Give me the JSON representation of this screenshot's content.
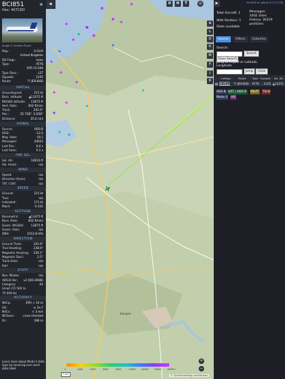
{
  "aircraft": {
    "callsign": "BCI851",
    "hex_label": "Hex:",
    "hex": "407C6D",
    "close": "✕",
    "photo_credit": "Image © Günther Rusch"
  },
  "details": [
    {
      "k": "Reg.:",
      "v": "G-GLO"
    },
    {
      "k": "",
      "v": "United Kingdom"
    },
    {
      "k": "DB Flags:",
      "v": "none"
    },
    {
      "k": "Type:",
      "v": "AT76"
    },
    {
      "k": "",
      "v": "ATR-72-500"
    },
    {
      "k": "Type Desc.:",
      "v": "L2T"
    },
    {
      "k": "Squawk:",
      "v": "2105"
    },
    {
      "k": "Route:",
      "v": "?? JER-BHD"
    }
  ],
  "sections": {
    "spatial": "SPATIAL",
    "signal": "SIGNAL",
    "fms": "FMS SEL",
    "wind": "WIND",
    "speed": "SPEED",
    "altitude": "ALTITUDE",
    "direction": "DIRECTION",
    "stuff": "STUFF",
    "accuracy": "ACCURACY"
  },
  "spatial": [
    {
      "k": "Groundspeed:",
      "v": "215 kt"
    },
    {
      "k": "Baro. altitude:",
      "v": "▲13375 ft"
    },
    {
      "k": "WGS84 altitude:",
      "v": "13675 ft"
    },
    {
      "k": "Vert. Rate:",
      "v": "832 ft/min"
    },
    {
      "k": "Track:",
      "v": "241.6°"
    },
    {
      "k": "Pos.:",
      "v": "52.758°, 5.658°"
    },
    {
      "k": "Distance:",
      "v": "25.6 nmi"
    }
  ],
  "signal": [
    {
      "k": "Source:",
      "v": "ADS-B"
    },
    {
      "k": "RSSI:",
      "v": "-12.5"
    },
    {
      "k": "Msg. Rate:",
      "v": "19.1"
    },
    {
      "k": "Messages:",
      "v": "34622"
    },
    {
      "k": "Last Pos.:",
      "v": "0.4 s"
    },
    {
      "k": "Last Seen:",
      "v": "0.1 s"
    }
  ],
  "fms": [
    {
      "k": "Sel. Alt.:",
      "v": "16016 ft"
    },
    {
      "k": "Sel. Head.:",
      "v": "n/a"
    }
  ],
  "wind": [
    {
      "k": "Speed:",
      "v": "n/a"
    },
    {
      "k": "Direction (from):",
      "v": "n/a"
    },
    {
      "k": "TAT / OAT:",
      "v": "n/a"
    }
  ],
  "speed": [
    {
      "k": "Ground:",
      "v": "215 kt"
    },
    {
      "k": "True:",
      "v": "n/a"
    },
    {
      "k": "Indicated:",
      "v": "171 kt"
    },
    {
      "k": "Mach:",
      "v": "0.332"
    }
  ],
  "altitude": [
    {
      "k": "Barometric:",
      "v": "▲13375 ft"
    },
    {
      "k": "Baro. Rate:",
      "v": "832 ft/min"
    },
    {
      "k": "Geom. WGS84:",
      "v": "13675 ft"
    },
    {
      "k": "Geom. Rate:",
      "v": "n/a"
    },
    {
      "k": "QNH:",
      "v": "1012.8 hPa"
    }
  ],
  "direction": [
    {
      "k": "Ground Track:",
      "v": "241.6°"
    },
    {
      "k": "True Heading:",
      "v": "238.6°"
    },
    {
      "k": "Magnetic Heading:",
      "v": "236.1°"
    },
    {
      "k": "Magnetic Decl.:",
      "v": "2.5°"
    },
    {
      "k": "Track Rate:",
      "v": "n/a"
    },
    {
      "k": "Roll:",
      "v": "n/a"
    }
  ],
  "stuff": [
    {
      "k": "Nav. Modes:",
      "v": "n/a"
    },
    {
      "k": "ADS-B Ver.:",
      "v": "v2 (DO-260B)"
    },
    {
      "k": "Category:",
      "v": "A2"
    },
    {
      "k": "Small (15 500 to",
      "v": ""
    },
    {
      "k": "75 000 lb)",
      "v": ""
    }
  ],
  "accuracy": [
    {
      "k": "NACp:",
      "v": "EPU < 10 m"
    },
    {
      "k": "SIL:",
      "v": "≤ 1e-7"
    },
    {
      "k": "NACv:",
      "v": "< 3 m/s"
    },
    {
      "k": "NICbaro:",
      "v": "cross-checked"
    },
    {
      "k": "Rc:",
      "v": "186 m"
    }
  ],
  "note": "Learn more about Mode S data type by hovering over each data label.",
  "map": {
    "top_buttons": [
      "U",
      "H",
      "T"
    ],
    "right_buttons": [
      "L",
      "O",
      "K",
      "M",
      "P",
      "I",
      "R"
    ],
    "scale": "5 km",
    "legend_ticks": [
      "0",
      "2000",
      "4000",
      "6000",
      "8000",
      "10000",
      "20000",
      "30000",
      "40000+"
    ],
    "osm": "© OpenStreetMap contributors",
    "zoom_in": "+",
    "zoom_out": "−",
    "nav_left": "◀",
    "nav_right": "▶",
    "place": "Kampen"
  },
  "right": {
    "top_link": "tar1090 on github (3.14.1776)",
    "total_aircraft_label": "Total Aircraft: 1",
    "with_position": "With Position: 1",
    "stats": "Stats available",
    "messages": "Messages: 1402.3/sec",
    "history": "History: 30319 positions",
    "tabs": [
      "Search",
      "Filters",
      "Columns"
    ],
    "search_label": "Search:",
    "search_btn": "Search",
    "clear_btn": "Clear Search",
    "jump_label": "Jump to Airport or Latitude, Longitude:",
    "jump_btn": "Jump",
    "clear2": "Clear",
    "table_headers": [
      "Callsign",
      "Route",
      "Type",
      "Squawk",
      "Alt. (ft)"
    ],
    "table_row": [
      "BCI851",
      "?? JER-BHD",
      "AT76",
      "2105",
      "▲13375"
    ],
    "chips": [
      "ADS-B",
      "UAT / ADS-R",
      "MLAT",
      "TIS-B"
    ],
    "chips2": [
      "Mode S",
      "AIS"
    ]
  }
}
